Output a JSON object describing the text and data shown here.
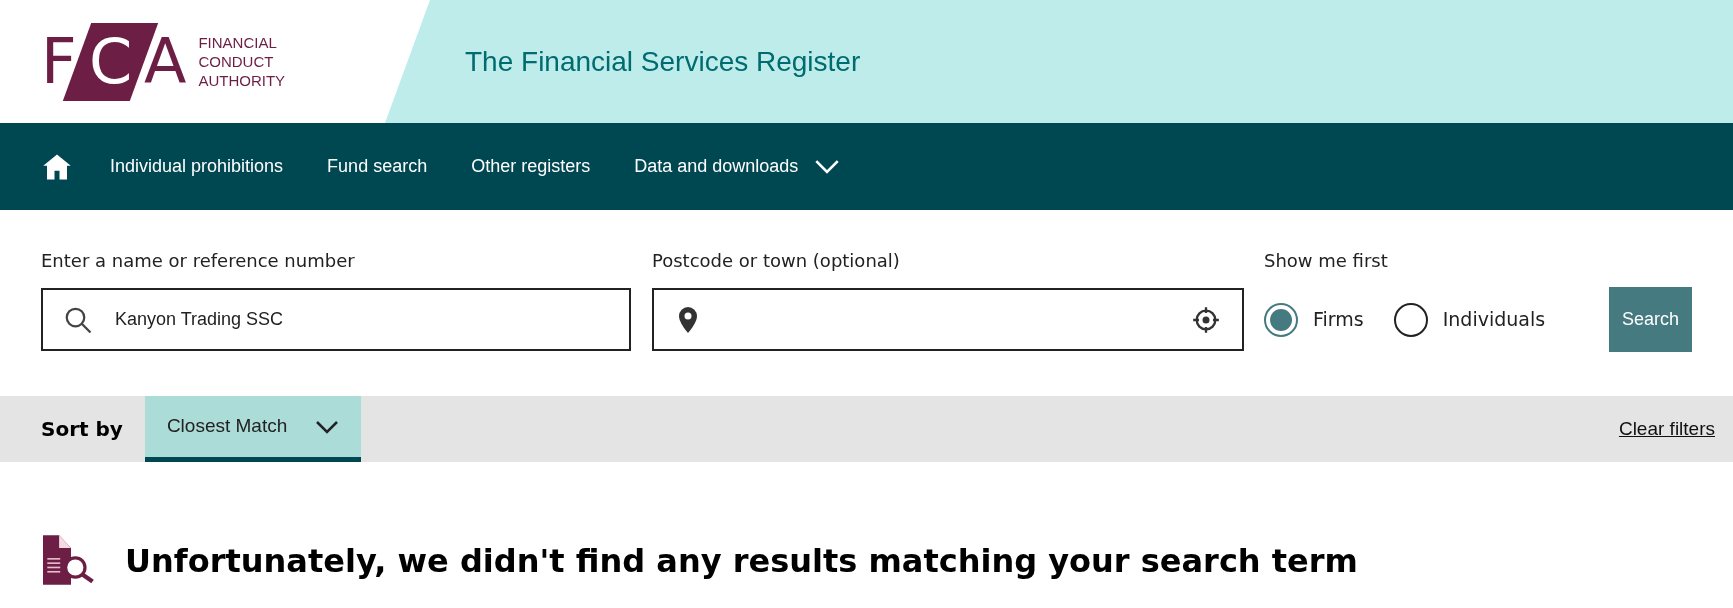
{
  "logo": {
    "letters": [
      "F",
      "C",
      "A"
    ],
    "lines": [
      "FINANCIAL",
      "CONDUCT",
      "AUTHORITY"
    ]
  },
  "header": {
    "title": "The Financial Services Register"
  },
  "nav": {
    "items": [
      {
        "label": "Individual prohibitions",
        "kind": "link"
      },
      {
        "label": "Fund search",
        "kind": "link"
      },
      {
        "label": "Other registers",
        "kind": "link"
      },
      {
        "label": "Data and downloads",
        "kind": "dropdown"
      }
    ]
  },
  "search": {
    "name_label": "Enter a name or reference number",
    "name_value": "Kanyon Trading SSC",
    "postcode_label": "Postcode or town (optional)",
    "show_label": "Show me first",
    "options": [
      {
        "label": "Firms",
        "selected": true
      },
      {
        "label": "Individuals",
        "selected": false
      }
    ],
    "button": "Search"
  },
  "sort": {
    "label": "Sort by",
    "value": "Closest Match",
    "clear": "Clear filters"
  },
  "message": "Unfortunately, we didn't find any results matching your search term"
}
